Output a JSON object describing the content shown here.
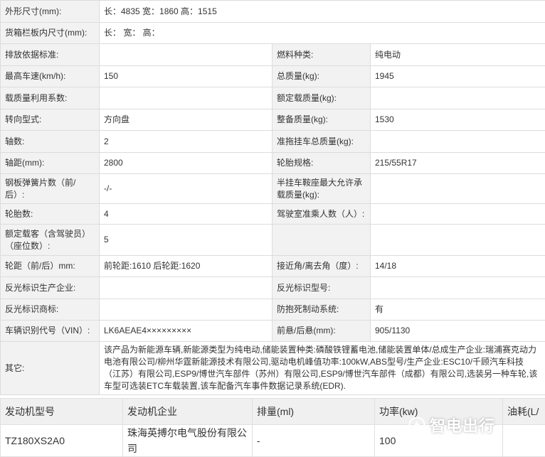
{
  "spec_rows": [
    {
      "type": "wide",
      "height": 31,
      "label": "外形尺寸(mm):",
      "value": "长：4835 宽：1860 高：1515"
    },
    {
      "type": "wide",
      "height": 30,
      "label": "货箱栏板内尺寸(mm):",
      "value": "长：  宽：  高："
    },
    {
      "type": "pair",
      "height": 31,
      "l1": "排放依据标准:",
      "v1": "",
      "l2": "燃料种类:",
      "v2": "纯电动"
    },
    {
      "type": "pair",
      "height": 30,
      "l1": "最高车速(km/h):",
      "v1": "150",
      "l2": "总质量(kg):",
      "v2": "1945"
    },
    {
      "type": "pair",
      "height": 31,
      "l1": "载质量利用系数:",
      "v1": "",
      "l2": "额定载质量(kg):",
      "v2": ""
    },
    {
      "type": "pair",
      "height": 30,
      "l1": "转向型式:",
      "v1": "方向盘",
      "l2": "整备质量(kg):",
      "v2": "1530"
    },
    {
      "type": "pair",
      "height": 31,
      "l1": "轴数:",
      "v1": "2",
      "l2": "准拖挂车总质量(kg):",
      "v2": ""
    },
    {
      "type": "pair",
      "height": 30,
      "l1": "轴距(mm):",
      "v1": "2800",
      "l2": "轮胎规格:",
      "v2": "215/55R17"
    },
    {
      "type": "pair",
      "height": 42,
      "l1": "钢板弹簧片数（前/后）:",
      "v1": "-/-",
      "l2": "半挂车鞍座最大允许承载质量(kg):",
      "v2": ""
    },
    {
      "type": "pair",
      "height": 29,
      "l1": "轮胎数:",
      "v1": "4",
      "l2": "驾驶室准乘人数（人）:",
      "v2": ""
    },
    {
      "type": "pair",
      "height": 44,
      "l1": "额定载客（含驾驶员）（座位数）:",
      "v1": "5",
      "l2": "",
      "v2": ""
    },
    {
      "type": "pair",
      "height": 30,
      "l1": "轮距（前/后）mm:",
      "v1": "前轮距:1610 后轮距:1620",
      "l2": "接近角/离去角（度）:",
      "v2": "14/18"
    },
    {
      "type": "pair",
      "height": 31,
      "l1": "反光标识生产企业:",
      "v1": "",
      "l2": "反光标识型号:",
      "v2": ""
    },
    {
      "type": "pair",
      "height": 30,
      "l1": "反光标识商标:",
      "v1": "",
      "l2": "防抱死制动系统:",
      "v2": "有"
    },
    {
      "type": "pair",
      "height": 30,
      "l1": "车辆识别代号（VIN）:",
      "v1": "LK6AEAE4×××××××××",
      "l2": "前悬/后悬(mm):",
      "v2": "905/1130"
    },
    {
      "type": "wide",
      "height": 75,
      "label": "其它:",
      "value": "该产品为新能源车辆,新能源类型为纯电动,储能装置种类:磷酸铁锂蓄电池,储能装置单体/总成生产企业:瑞浦赛克动力电池有限公司/柳州华霆新能源技术有限公司,驱动电机峰值功率:100kW,ABS型号/生产企业:ESC10/千顾汽车科技（江苏）有限公司,ESP9/博世汽车部件（苏州）有限公司,ESP9/博世汽车部件（成都）有限公司,选装另一种车轮,该车型可选装ETC车载装置,该车配备汽车事件数据记录系统(EDR)."
    }
  ],
  "engine_table": {
    "headers": [
      "发动机型号",
      "发动机企业",
      "排量(ml)",
      "功率(kw)",
      "油耗(L/"
    ],
    "rows": [
      [
        "TZ180XS2A0",
        "珠海英搏尔电气股份有限公司",
        "-",
        "100",
        ""
      ]
    ]
  },
  "watermark": {
    "text": "智电出行",
    "icon": "lightning-icon"
  }
}
